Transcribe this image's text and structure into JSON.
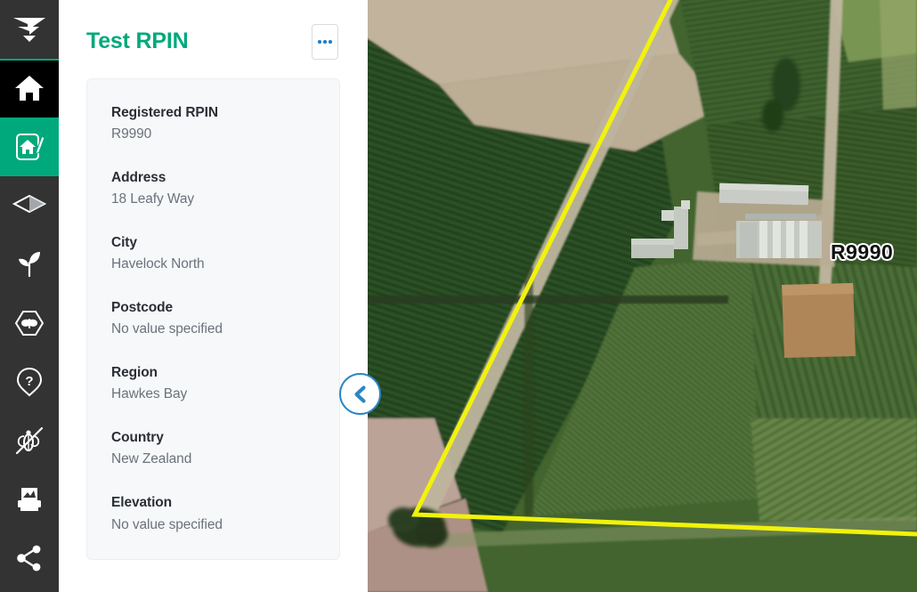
{
  "app": {
    "accent_green": "#00a97c",
    "sidebar_bg": "#333333",
    "link_blue": "#1f7fc4",
    "boundary_yellow": "#f2f20a"
  },
  "sidebar": {
    "items": [
      {
        "name": "logo",
        "icon": "paper-plane-logo-icon",
        "label": "Logo",
        "state": "logo"
      },
      {
        "name": "home",
        "icon": "home-icon",
        "label": "Home",
        "state": "selected-dark"
      },
      {
        "name": "property-registration",
        "icon": "house-edit-icon",
        "label": "Property Registration",
        "state": "active"
      },
      {
        "name": "layers",
        "icon": "layers-icon",
        "label": "Layers",
        "state": "normal"
      },
      {
        "name": "crops",
        "icon": "seedling-icon",
        "label": "Crops",
        "state": "normal"
      },
      {
        "name": "pests",
        "icon": "insect-hexagon-icon",
        "label": "Pests",
        "state": "normal"
      },
      {
        "name": "unknown-find",
        "icon": "question-pin-icon",
        "label": "Unknown Find",
        "state": "normal"
      },
      {
        "name": "no-pest",
        "icon": "insect-slashed-icon",
        "label": "No Pest Found",
        "state": "normal"
      },
      {
        "name": "print-map",
        "icon": "print-map-icon",
        "label": "Print Map",
        "state": "normal"
      },
      {
        "name": "share",
        "icon": "share-icon",
        "label": "Share",
        "state": "normal"
      }
    ]
  },
  "panel": {
    "title": "Test RPIN",
    "more_button": {
      "name": "more-options-button",
      "label": "..."
    },
    "fields": [
      {
        "label": "Registered RPIN",
        "value": "R9990"
      },
      {
        "label": "Address",
        "value": "18 Leafy Way"
      },
      {
        "label": "City",
        "value": "Havelock North"
      },
      {
        "label": "Postcode",
        "value": "No value specified"
      },
      {
        "label": "Region",
        "value": "Hawkes Bay"
      },
      {
        "label": "Country",
        "value": "New Zealand"
      },
      {
        "label": "Elevation",
        "value": "No value specified"
      }
    ]
  },
  "map": {
    "boundary_label": "R9990",
    "collapse_button_label": "Collapse panel",
    "basemap": "satellite-aerial-imagery"
  }
}
